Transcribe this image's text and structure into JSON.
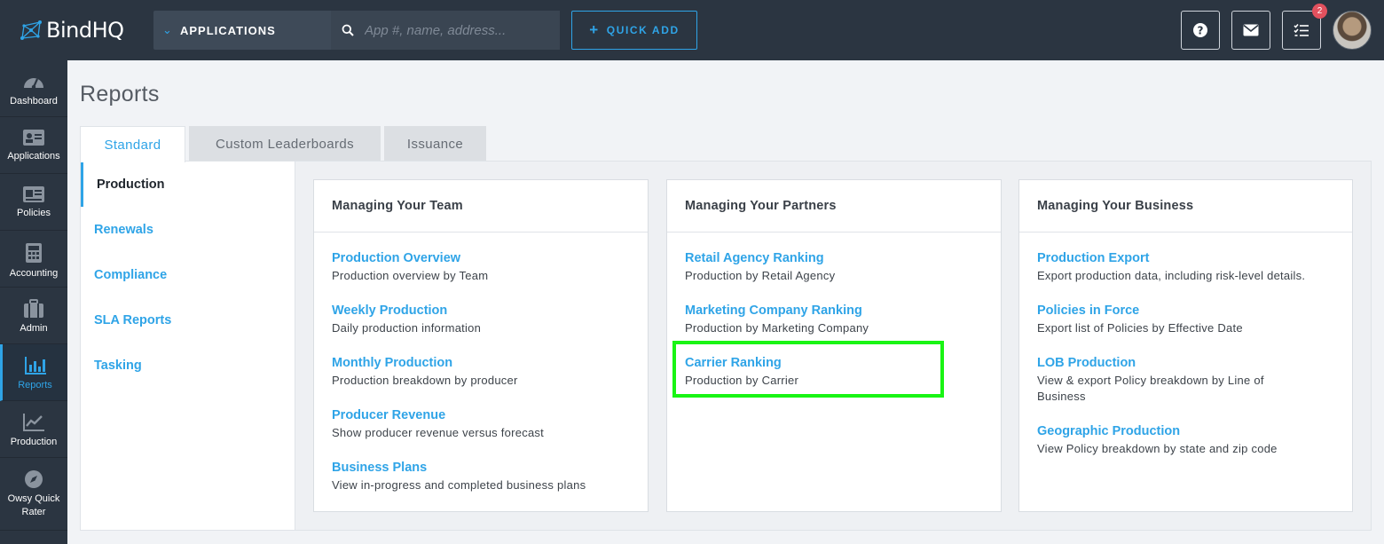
{
  "app": {
    "brand": "BindHQ"
  },
  "header": {
    "module_select": "APPLICATIONS",
    "search_placeholder": "App #, name, address...",
    "quick_add": "QUICK ADD",
    "tasks_badge": "2"
  },
  "sidebar": {
    "items": [
      {
        "label": "Dashboard",
        "icon": "gauge-icon"
      },
      {
        "label": "Applications",
        "icon": "id-card-icon"
      },
      {
        "label": "Policies",
        "icon": "policy-card-icon"
      },
      {
        "label": "Accounting",
        "icon": "calculator-icon"
      },
      {
        "label": "Admin",
        "icon": "briefcase-icon"
      },
      {
        "label": "Reports",
        "icon": "bar-chart-icon",
        "active": true
      },
      {
        "label": "Production",
        "icon": "trend-chart-icon"
      },
      {
        "label": "Owsy Quick Rater",
        "icon": "compass-icon"
      }
    ]
  },
  "page": {
    "title": "Reports"
  },
  "tabs": [
    {
      "label": "Standard",
      "active": true
    },
    {
      "label": "Custom Leaderboards"
    },
    {
      "label": "Issuance"
    }
  ],
  "subnav": [
    {
      "label": "Production",
      "active": true
    },
    {
      "label": "Renewals"
    },
    {
      "label": "Compliance"
    },
    {
      "label": "SLA Reports"
    },
    {
      "label": "Tasking"
    }
  ],
  "cards": [
    {
      "title": "Managing Your Team",
      "reports": [
        {
          "title": "Production Overview",
          "desc": "Production overview by Team"
        },
        {
          "title": "Weekly Production",
          "desc": "Daily production information"
        },
        {
          "title": "Monthly Production",
          "desc": "Production breakdown by producer"
        },
        {
          "title": "Producer Revenue",
          "desc": "Show producer revenue versus forecast"
        },
        {
          "title": "Business Plans",
          "desc": "View in-progress and completed business plans"
        }
      ]
    },
    {
      "title": "Managing Your Partners",
      "reports": [
        {
          "title": "Retail Agency Ranking",
          "desc": "Production by Retail Agency"
        },
        {
          "title": "Marketing Company Ranking",
          "desc": "Production by Marketing Company"
        },
        {
          "title": "Carrier Ranking",
          "desc": "Production by Carrier"
        }
      ]
    },
    {
      "title": "Managing Your Business",
      "reports": [
        {
          "title": "Production Export",
          "desc": "Export production data, including risk-level details."
        },
        {
          "title": "Policies in Force",
          "desc": "Export list of Policies by Effective Date"
        },
        {
          "title": "LOB Production",
          "desc": "View & export Policy breakdown by Line of",
          "desc2": "Business"
        },
        {
          "title": "Geographic Production",
          "desc": "View Policy breakdown by state and zip code"
        }
      ]
    }
  ],
  "colors": {
    "accent": "#2fa4e7",
    "topbar": "#2b3541",
    "highlight": "#19f514",
    "badge": "#e2515e"
  }
}
